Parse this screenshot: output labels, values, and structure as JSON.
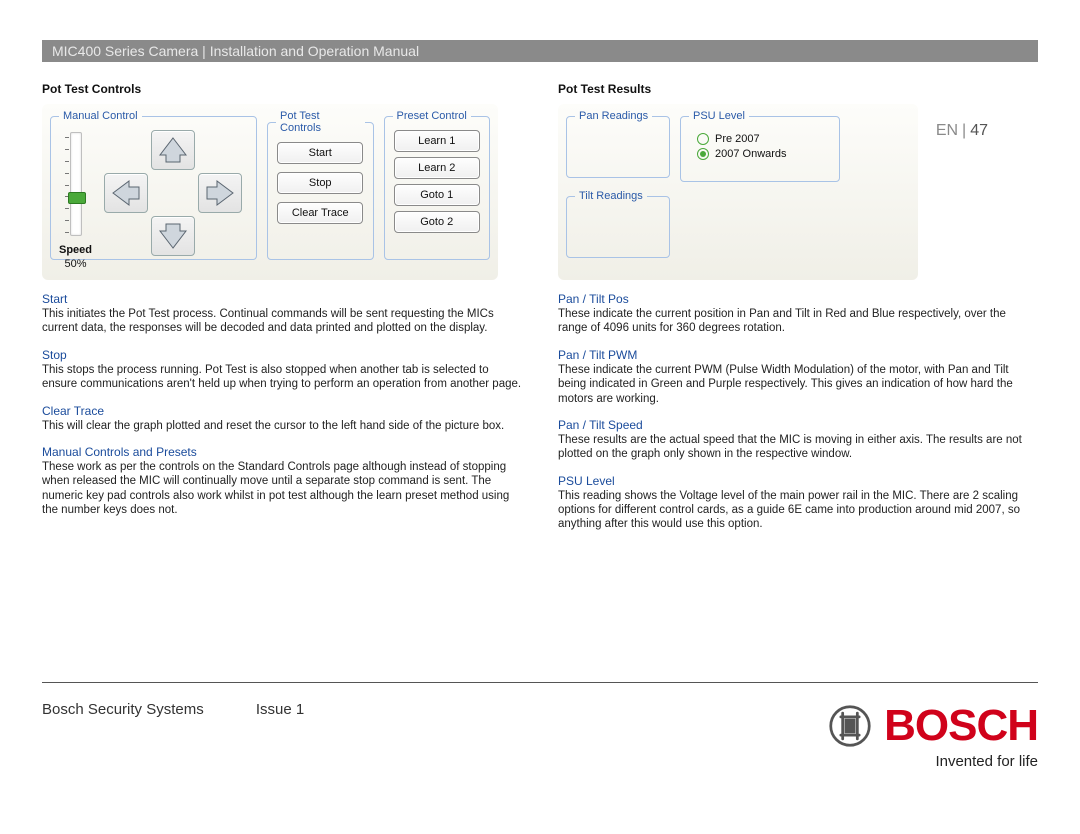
{
  "header": {
    "title": "MIC400 Series Camera | Installation and Operation Manual",
    "lang": "EN",
    "page": "47"
  },
  "left": {
    "title": "Pot Test Controls",
    "manual_control_legend": "Manual Control",
    "speed_label": "Speed",
    "speed_value": "50%",
    "pot_test_legend": "Pot Test Controls",
    "btn_start": "Start",
    "btn_stop": "Stop",
    "btn_clear": "Clear Trace",
    "preset_legend": "Preset Control",
    "btn_learn1": "Learn 1",
    "btn_learn2": "Learn 2",
    "btn_goto1": "Goto 1",
    "btn_goto2": "Goto 2",
    "sections": {
      "start": {
        "term": "Start",
        "body": "This initiates the Pot Test process. Continual commands will be sent requesting the MICs current data, the responses will be decoded and data printed and plotted on the display."
      },
      "stop": {
        "term": "Stop",
        "body": "This stops the process running. Pot Test is also stopped when another tab is selected to ensure communications aren't held up when trying to perform an operation from another page."
      },
      "clear": {
        "term": "Clear Trace",
        "body": "This will clear the graph plotted and reset the cursor to the left hand side of the picture box."
      },
      "mcp": {
        "term": "Manual Controls and Presets",
        "body": "These work as per the controls on the Standard Controls page although instead of stopping when released the MIC will continually move until a separate stop command is sent. The numeric key pad controls also work whilst in pot test although the learn preset method using the number keys does not."
      }
    }
  },
  "right": {
    "title": "Pot Test Results",
    "pan_readings_legend": "Pan Readings",
    "tilt_readings_legend": "Tilt Readings",
    "psu_legend": "PSU Level",
    "psu_opt1": "Pre 2007",
    "psu_opt2": "2007 Onwards",
    "sections": {
      "pos": {
        "term": "Pan / Tilt Pos",
        "body": "These indicate the current position in Pan and Tilt in Red and Blue respectively, over the range of 4096 units for 360 degrees rotation."
      },
      "pwm": {
        "term": "Pan / Tilt PWM",
        "body": "These indicate the current PWM (Pulse Width Modulation) of the motor, with Pan and Tilt being indicated in Green and Purple respectively. This gives an indication of how hard the motors are working."
      },
      "speed": {
        "term": "Pan / Tilt Speed",
        "body": "These results are the actual speed that the MIC is moving in either axis. The results are not plotted on the graph only shown in the respective window."
      },
      "psu": {
        "term": "PSU Level",
        "body": "This reading shows the Voltage level of the main power rail in the MIC. There are 2 scaling options for different control cards, as a guide 6E came into production around mid 2007, so anything after this would use this option."
      }
    }
  },
  "footer": {
    "company": "Bosch Security Systems",
    "issue": "Issue 1",
    "brand": "BOSCH",
    "tagline": "Invented for life"
  }
}
